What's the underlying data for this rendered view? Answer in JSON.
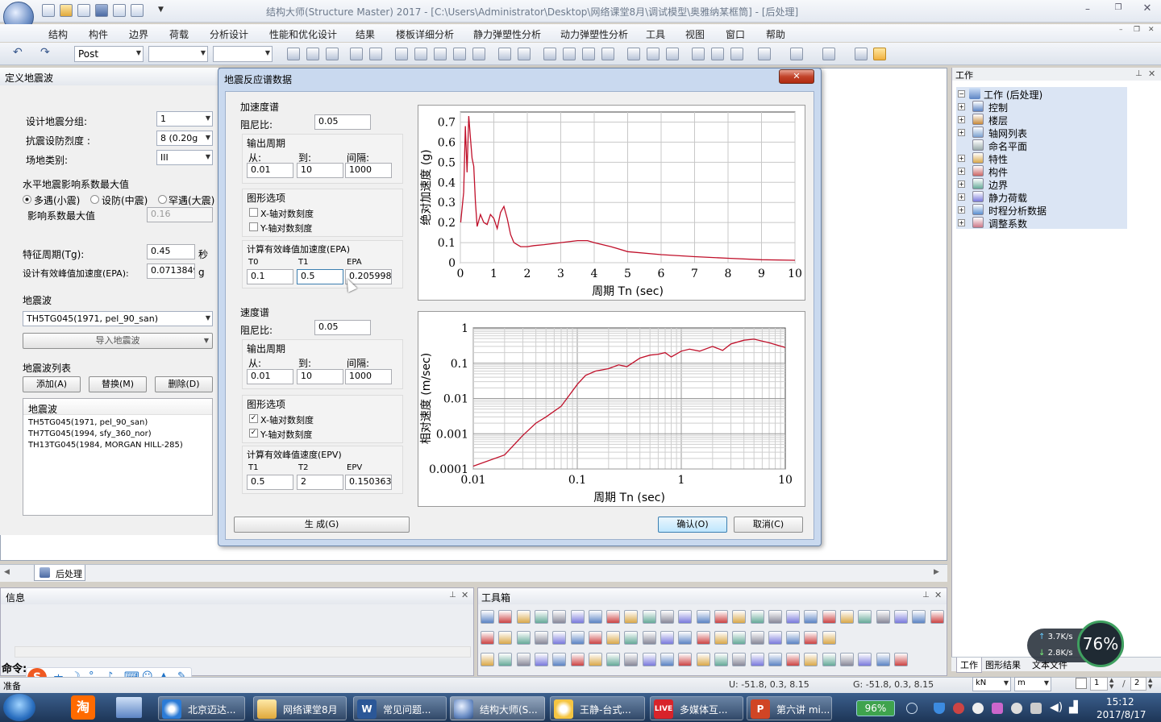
{
  "app": {
    "title": "结构大师(Structure Master) 2017 - [C:\\Users\\Administrator\\Desktop\\网络课堂8月\\调试模型\\奥雅纳某框筒] - [后处理]"
  },
  "menu": [
    "结构",
    "构件",
    "边界",
    "荷载",
    "分析设计",
    "性能和优化设计",
    "结果",
    "楼板详细分析",
    "静力弹塑性分析",
    "动力弹塑性分析",
    "工具",
    "视图",
    "窗口",
    "帮助"
  ],
  "toolbar": {
    "post_combo": "Post"
  },
  "left_panel": {
    "title": "定义地震波",
    "design_group_label": "设计地震分组:",
    "design_group_value": "1",
    "intensity_label": "抗震设防烈度 :",
    "intensity_value": "8 (0.20g",
    "site_label": "场地类别:",
    "site_value": "III",
    "hor_title": "水平地震影响系数最大值",
    "radio_frequent": "多遇(小震)",
    "radio_fortify": "设防(中震)",
    "radio_rare": "罕遇(大震)",
    "alpha_max_label": "影响系数最大值",
    "alpha_max_value": "0.16",
    "tg_label": "特征周期(Tg):",
    "tg_value": "0.45",
    "tg_unit": "秒",
    "epa_label": "设计有效峰值加速度(EPA):",
    "epa_value": "0.0713849",
    "epa_unit": "g",
    "wave_label": "地震波",
    "wave_value": "TH5TG045(1971, pel_90_san)",
    "import_button": "导入地震波",
    "list_label": "地震波列表",
    "add_button": "添加(A)",
    "replace_button": "替换(M)",
    "delete_button": "删除(D)",
    "list_header": "地震波",
    "list_items": [
      "TH5TG045(1971, pel_90_san)",
      "TH7TG045(1994, sfy_360_nor)",
      "TH13TG045(1984, MORGAN HILL-285)"
    ]
  },
  "dialog": {
    "title": "地震反应谱数据",
    "close": "✕",
    "accel": {
      "title": "加速度谱",
      "damping_label": "阻尼比:",
      "damping_value": "0.05",
      "period_title": "输出周期",
      "from_label": "从:",
      "to_label": "到:",
      "step_label": "间隔:",
      "from_value": "0.01",
      "to_value": "10",
      "step_value": "1000",
      "graph_options": "图形选项",
      "x_log": "X-轴对数刻度",
      "y_log": "Y-轴对数刻度",
      "epa_title": "计算有效峰值加速度(EPA)",
      "t0_label": "T0",
      "t1_label": "T1",
      "epa_label": "EPA",
      "t0_value": "0.1",
      "t1_value": "0.5",
      "epa_value": "0.2059986"
    },
    "vel": {
      "title": "速度谱",
      "damping_label": "阻尼比:",
      "damping_value": "0.05",
      "period_title": "输出周期",
      "from_label": "从:",
      "to_label": "到:",
      "step_label": "间隔:",
      "from_value": "0.01",
      "to_value": "10",
      "step_value": "1000",
      "graph_options": "图形选项",
      "x_log": "X-轴对数刻度",
      "y_log": "Y-轴对数刻度",
      "epv_title": "计算有效峰值速度(EPV)",
      "t1_label": "T1",
      "t2_label": "T2",
      "epv_label": "EPV",
      "t1_value": "0.5",
      "t2_value": "2",
      "epv_value": "0.1503637"
    },
    "generate_button": "生 成(G)",
    "ok_button": "确认(O)",
    "cancel_button": "取消(C)"
  },
  "right_panel": {
    "title": "工作",
    "root": "工作 (后处理)",
    "items": [
      "控制",
      "楼层",
      "轴网列表",
      "命名平面",
      "特性",
      "构件",
      "边界",
      "静力荷载",
      "时程分析数据",
      "调整系数"
    ],
    "tabs": [
      "工作",
      "图形结果",
      "文本文件"
    ]
  },
  "tab_bar": {
    "tab": "后处理"
  },
  "info_panel": {
    "title": "信息",
    "command_label": "命令:"
  },
  "toolbox_panel": {
    "title": "工具箱"
  },
  "status": {
    "ready": "准备",
    "u_coord": "U: -51.8, 0.3, 8.15",
    "g_coord": "G: -51.8, 0.3, 8.15",
    "force_unit": "kN",
    "length_unit": "m",
    "page": "1",
    "page_total": "2"
  },
  "net": {
    "up": "3.7K/s",
    "down": "2.8K/s",
    "percent": "76%"
  },
  "taskbar": {
    "items": [
      "北京迈达...",
      "网络课堂8月",
      "常见问题...",
      "结构大师(S...",
      "王静-台式...",
      "多媒体互...",
      "第六讲 mi..."
    ],
    "battery": "96%",
    "time": "15:12",
    "date": "2017/8/17"
  },
  "chart_data": [
    {
      "type": "line",
      "title": "",
      "xlabel": "周期 Tn (sec)",
      "ylabel": "绝对加速度 (g)",
      "xlim": [
        0,
        10
      ],
      "ylim": [
        0,
        0.75
      ],
      "x_ticks": [
        0,
        1,
        2,
        3,
        4,
        5,
        6,
        7,
        8,
        9,
        10
      ],
      "y_ticks": [
        0,
        0.1,
        0.2,
        0.3,
        0.4,
        0.5,
        0.6,
        0.7
      ],
      "grid": true,
      "series": [
        {
          "color": "#c0102a",
          "x": [
            0.01,
            0.1,
            0.15,
            0.2,
            0.25,
            0.3,
            0.35,
            0.4,
            0.45,
            0.5,
            0.6,
            0.7,
            0.8,
            0.9,
            1.0,
            1.1,
            1.2,
            1.3,
            1.4,
            1.5,
            1.6,
            1.7,
            1.8,
            2.0,
            2.2,
            2.5,
            3.0,
            3.5,
            3.8,
            4.0,
            4.5,
            5.0,
            6.0,
            7.0,
            8.0,
            9.0,
            10.0
          ],
          "y": [
            0.2,
            0.35,
            0.68,
            0.45,
            0.73,
            0.62,
            0.52,
            0.48,
            0.3,
            0.18,
            0.24,
            0.2,
            0.19,
            0.24,
            0.22,
            0.17,
            0.25,
            0.28,
            0.22,
            0.14,
            0.1,
            0.09,
            0.08,
            0.08,
            0.085,
            0.09,
            0.1,
            0.11,
            0.11,
            0.1,
            0.08,
            0.055,
            0.04,
            0.03,
            0.022,
            0.015,
            0.012
          ]
        }
      ]
    },
    {
      "type": "line",
      "title": "",
      "xlabel": "周期 Tn (sec)",
      "ylabel": "相对速度 (m/sec)",
      "x_scale": "log",
      "y_scale": "log",
      "xlim": [
        0.01,
        10
      ],
      "ylim": [
        0.0001,
        1
      ],
      "x_ticks": [
        "0.01",
        "0.1",
        "1",
        "10"
      ],
      "y_ticks": [
        "0.0001",
        "0.001",
        "0.01",
        "0.1",
        "1"
      ],
      "grid": true,
      "series": [
        {
          "color": "#c0102a",
          "x": [
            0.01,
            0.02,
            0.03,
            0.04,
            0.05,
            0.07,
            0.1,
            0.12,
            0.15,
            0.2,
            0.25,
            0.3,
            0.4,
            0.5,
            0.6,
            0.7,
            0.8,
            1.0,
            1.2,
            1.5,
            2.0,
            2.5,
            3.0,
            4.0,
            5.0,
            7.0,
            10.0
          ],
          "y": [
            0.00012,
            0.00025,
            0.0009,
            0.002,
            0.003,
            0.006,
            0.025,
            0.045,
            0.06,
            0.07,
            0.09,
            0.08,
            0.14,
            0.17,
            0.18,
            0.2,
            0.15,
            0.22,
            0.25,
            0.22,
            0.3,
            0.23,
            0.35,
            0.45,
            0.48,
            0.38,
            0.28
          ]
        }
      ]
    }
  ]
}
